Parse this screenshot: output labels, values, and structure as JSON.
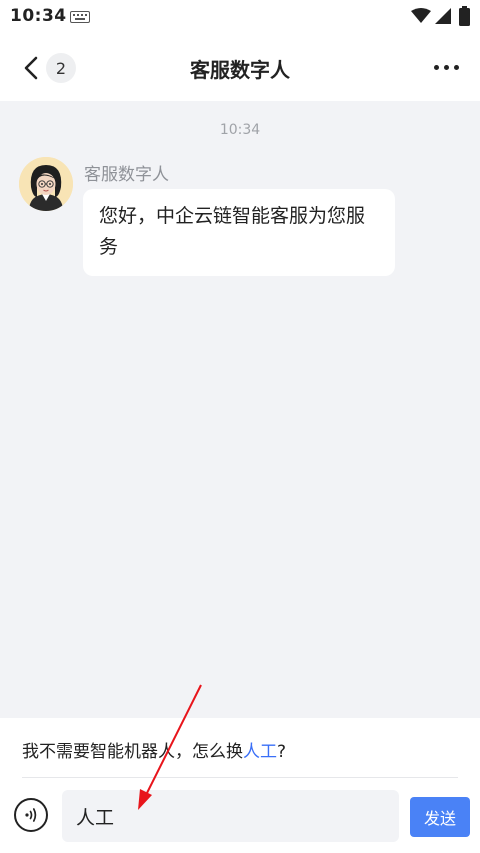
{
  "status_bar": {
    "time": "10:34",
    "icons": [
      "keyboard-icon",
      "wifi-icon",
      "signal-icon",
      "battery-icon"
    ]
  },
  "nav": {
    "back_count": "2",
    "title": "客服数字人",
    "icons": [
      "chevron-left-icon",
      "more-icon"
    ]
  },
  "chat": {
    "timestamp": "10:34",
    "messages": [
      {
        "sender": "客服数字人",
        "text": "您好，中企云链智能客服为您服务"
      }
    ]
  },
  "suggestion": {
    "prefix": "我不需要智能机器人，怎么换",
    "link": "人工",
    "suffix": "?"
  },
  "input": {
    "value": "人工",
    "send_label": "发送"
  },
  "colors": {
    "accent": "#4a82f6",
    "link": "#3a6ff7",
    "chat_background": "#f2f3f6",
    "annotation_arrow": "#e8141b"
  }
}
